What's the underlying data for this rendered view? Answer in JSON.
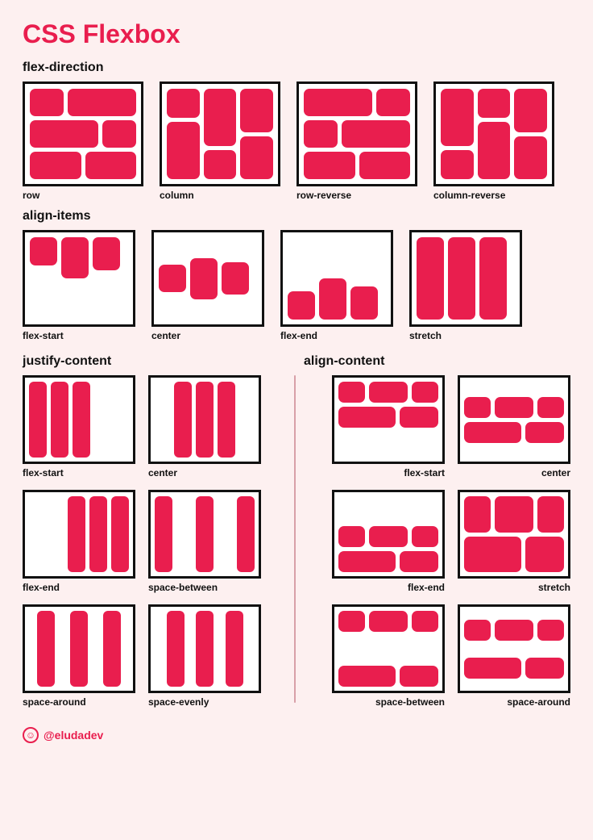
{
  "title": "CSS Flexbox",
  "footer_handle": "@eludadev",
  "sections": {
    "flex_direction": {
      "heading": "flex-direction",
      "items": [
        "row",
        "column",
        "row-reverse",
        "column-reverse"
      ]
    },
    "align_items": {
      "heading": "align-items",
      "items": [
        "flex-start",
        "center",
        "flex-end",
        "stretch"
      ]
    },
    "justify_content": {
      "heading": "justify-content",
      "items": [
        "flex-start",
        "center",
        "flex-end",
        "space-between",
        "space-around",
        "space-evenly"
      ]
    },
    "align_content": {
      "heading": "align-content",
      "items": [
        "flex-start",
        "center",
        "flex-end",
        "stretch",
        "space-between",
        "space-around"
      ]
    }
  }
}
